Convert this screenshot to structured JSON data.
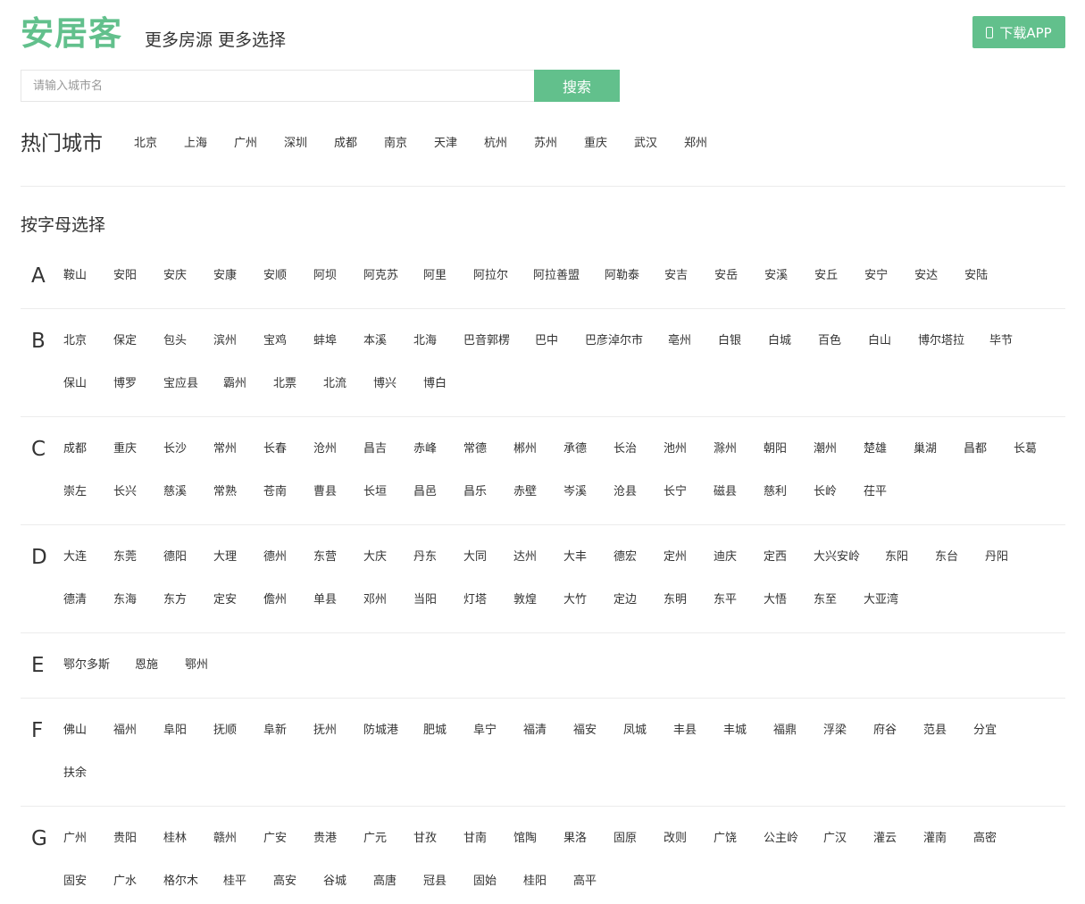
{
  "header": {
    "logo": "安居客",
    "slogan": "更多房源 更多选择",
    "download_label": "下载APP",
    "download_icon": "phone-icon"
  },
  "search": {
    "placeholder": "请输入城市名",
    "value": "",
    "button_label": "搜索"
  },
  "hot": {
    "title": "热门城市",
    "cities": [
      "北京",
      "上海",
      "广州",
      "深圳",
      "成都",
      "南京",
      "天津",
      "杭州",
      "苏州",
      "重庆",
      "武汉",
      "郑州"
    ]
  },
  "by_letter": {
    "title": "按字母选择",
    "groups": [
      {
        "letter": "A",
        "cities": [
          "鞍山",
          "安阳",
          "安庆",
          "安康",
          "安顺",
          "阿坝",
          "阿克苏",
          "阿里",
          "阿拉尔",
          "阿拉善盟",
          "阿勒泰",
          "安吉",
          "安岳",
          "安溪",
          "安丘",
          "安宁",
          "安达",
          "安陆"
        ]
      },
      {
        "letter": "B",
        "cities": [
          "北京",
          "保定",
          "包头",
          "滨州",
          "宝鸡",
          "蚌埠",
          "本溪",
          "北海",
          "巴音郭楞",
          "巴中",
          "巴彦淖尔市",
          "亳州",
          "白银",
          "白城",
          "百色",
          "白山",
          "博尔塔拉",
          "毕节",
          "保山",
          "博罗",
          "宝应县",
          "霸州",
          "北票",
          "北流",
          "博兴",
          "博白"
        ]
      },
      {
        "letter": "C",
        "cities": [
          "成都",
          "重庆",
          "长沙",
          "常州",
          "长春",
          "沧州",
          "昌吉",
          "赤峰",
          "常德",
          "郴州",
          "承德",
          "长治",
          "池州",
          "滁州",
          "朝阳",
          "潮州",
          "楚雄",
          "巢湖",
          "昌都",
          "长葛",
          "崇左",
          "长兴",
          "慈溪",
          "常熟",
          "苍南",
          "曹县",
          "长垣",
          "昌邑",
          "昌乐",
          "赤壁",
          "岑溪",
          "沧县",
          "长宁",
          "磁县",
          "慈利",
          "长岭",
          "茌平"
        ]
      },
      {
        "letter": "D",
        "cities": [
          "大连",
          "东莞",
          "德阳",
          "大理",
          "德州",
          "东营",
          "大庆",
          "丹东",
          "大同",
          "达州",
          "大丰",
          "德宏",
          "定州",
          "迪庆",
          "定西",
          "大兴安岭",
          "东阳",
          "东台",
          "丹阳",
          "德清",
          "东海",
          "东方",
          "定安",
          "儋州",
          "单县",
          "邓州",
          "当阳",
          "灯塔",
          "敦煌",
          "大竹",
          "定边",
          "东明",
          "东平",
          "大悟",
          "东至",
          "大亚湾"
        ]
      },
      {
        "letter": "E",
        "cities": [
          "鄂尔多斯",
          "恩施",
          "鄂州"
        ]
      },
      {
        "letter": "F",
        "cities": [
          "佛山",
          "福州",
          "阜阳",
          "抚顺",
          "阜新",
          "抚州",
          "防城港",
          "肥城",
          "阜宁",
          "福清",
          "福安",
          "凤城",
          "丰县",
          "丰城",
          "福鼎",
          "浮梁",
          "府谷",
          "范县",
          "分宜",
          "扶余"
        ]
      },
      {
        "letter": "G",
        "cities": [
          "广州",
          "贵阳",
          "桂林",
          "赣州",
          "广安",
          "贵港",
          "广元",
          "甘孜",
          "甘南",
          "馆陶",
          "果洛",
          "固原",
          "改则",
          "广饶",
          "公主岭",
          "广汉",
          "灌云",
          "灌南",
          "高密",
          "固安",
          "广水",
          "格尔木",
          "桂平",
          "高安",
          "谷城",
          "高唐",
          "冠县",
          "固始",
          "桂阳",
          "高平"
        ]
      }
    ]
  }
}
